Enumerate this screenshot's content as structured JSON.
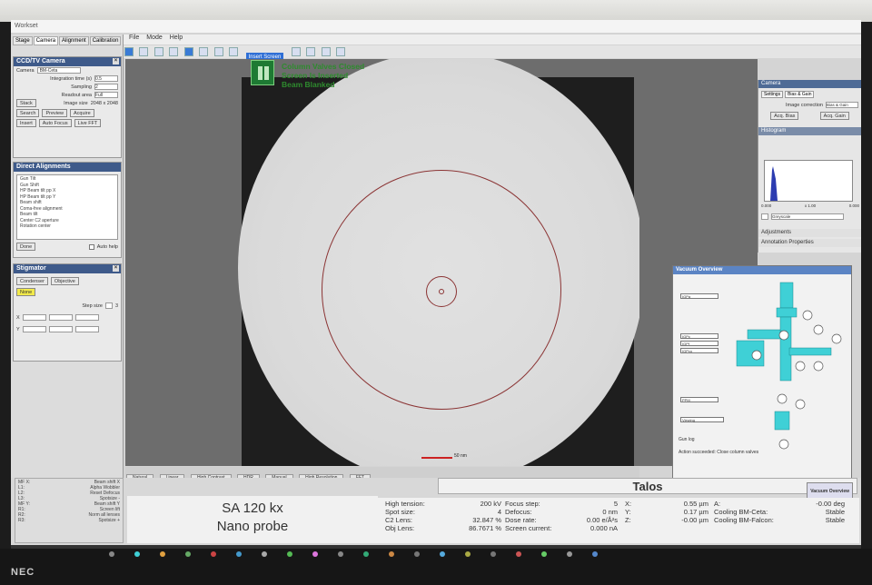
{
  "window": {
    "title": "Workset"
  },
  "left_tabs": [
    "Stage",
    "Camera",
    "Alignment",
    "Calibration"
  ],
  "menu": [
    "File",
    "Mode",
    "Help"
  ],
  "toolbar": {
    "insert_screen": "Insert Screen"
  },
  "camera_panel": {
    "title": "CCD/TV Camera",
    "camera_label": "Camera",
    "camera_value": "BM-Ceta",
    "integration_label": "Integration time (s)",
    "integration_value": "0.5",
    "sampling_label": "Sampling",
    "sampling_value": "2",
    "readout_label": "Readout area",
    "readout_value": "Full",
    "image_size_label": "Image size",
    "image_size_value": "2048 x 2048",
    "buttons": [
      "Stack",
      "Search",
      "Preview",
      "Acquire",
      "Insert",
      "Auto Focus",
      "Live FFT"
    ]
  },
  "alignments_panel": {
    "title": "Direct Alignments",
    "items": [
      "Gun Tilt",
      "Gun Shift",
      "HP Beam tilt pp X",
      "HP Beam tilt pp Y",
      "Beam shift",
      "Coma-free alignment",
      "Beam tilt",
      "Center C2 aperture",
      "Rotation center"
    ],
    "done_label": "Done",
    "autohelp_label": "Auto help"
  },
  "stigmator_panel": {
    "title": "Stigmator",
    "condenser_label": "Condenser",
    "objective_label": "Objective",
    "none_label": "None",
    "step_label": "Step size",
    "step_value": "3",
    "x_label": "X",
    "y_label": "Y"
  },
  "image_status": {
    "line1": "Column Valves Closed",
    "line2": "Screen Is Inserted",
    "line3": "Beam Blanked",
    "scale_label": "50 nm"
  },
  "filters": [
    "Natural",
    "Linear",
    "High Contrast",
    "HDR",
    "Manual",
    "High Resolution",
    "FFT"
  ],
  "camera_right": {
    "title": "Camera",
    "tabs": [
      "Settings",
      "Bias & Gain"
    ],
    "image_correction_label": "Image correction",
    "image_correction_value": "Bias & Gain",
    "acq_bias": "Acq. Bias",
    "acq_gain": "Acq. Gain",
    "histogram_label": "Histogram",
    "hist_min": "0.000",
    "hist_mid": "x 1.00",
    "hist_max": "0.000",
    "colormap": "Greyscale",
    "adjustments": "Adjustments",
    "annotation": "Annotation Properties"
  },
  "vacuum": {
    "title": "Vacuum Overview",
    "status1": "Gun log",
    "status2": "Action succeeded: Close column valves",
    "labels": [
      "IGPa",
      "IGPc",
      "IGPf",
      "IGPco",
      "PPM",
      "Viewing"
    ]
  },
  "legend": {
    "rows": [
      [
        "MF X:",
        "Beam shift X"
      ],
      [
        "L1:",
        "Alpha Wobbler"
      ],
      [
        "L2:",
        "Reset Defocus"
      ],
      [
        "L3:",
        "Spotsize -"
      ],
      [
        "MF Y:",
        "Beam shift Y"
      ],
      [
        "R1:",
        "Screen lift"
      ],
      [
        "R2:",
        "Norm all lenses"
      ],
      [
        "R3:",
        "Spotsize +"
      ]
    ]
  },
  "instrument": {
    "name": "Talos",
    "overview_btn": "Vacuum Overview",
    "mag_line1": "SA 120 kx",
    "mag_line2": "Nano probe"
  },
  "readouts": {
    "col1": [
      [
        "High tension:",
        "200 kV"
      ],
      [
        "Spot size:",
        "4"
      ],
      [
        "C2 Lens:",
        "32.847 %"
      ],
      [
        "Obj Lens:",
        "86.7671 %"
      ]
    ],
    "col2": [
      [
        "Focus step:",
        "5"
      ],
      [
        "Defocus:",
        "0 nm"
      ],
      [
        "Dose rate:",
        "0.00 e/Å²s"
      ],
      [
        "Screen current:",
        "0.000 nA"
      ]
    ],
    "col3": [
      [
        "X:",
        "0.55 µm"
      ],
      [
        "Y:",
        "0.17 µm"
      ],
      [
        "Z:",
        "-0.00 µm"
      ]
    ],
    "col4": [
      [
        "A:",
        "-0.00 deg"
      ],
      [
        "Cooling BM-Ceta:",
        "Stable"
      ],
      [
        "Cooling BM-Falcon:",
        "Stable"
      ]
    ]
  },
  "monitor": {
    "brand": "NEC"
  },
  "colors": {
    "status_green": "#2e8b2e",
    "header_blue": "#3e5a8a",
    "vacuum_cyan": "#3fd0d6"
  }
}
